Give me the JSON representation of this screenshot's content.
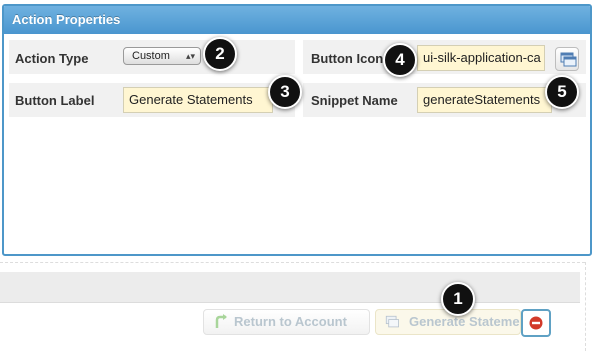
{
  "panel": {
    "title": "Action Properties"
  },
  "fields": {
    "action_type": {
      "label": "Action Type",
      "value": "Custom"
    },
    "button_icon": {
      "label": "Button Icon",
      "value": "ui-silk-application-ca"
    },
    "button_label": {
      "label": "Button Label",
      "value": "Generate Statements"
    },
    "snippet_name": {
      "label": "Snippet Name",
      "value": "generateStatements"
    }
  },
  "badges": [
    "1",
    "2",
    "3",
    "4",
    "5"
  ],
  "buttons": {
    "return_label": "Return to Account",
    "generate_label": "Generate Stateme"
  },
  "colors": {
    "panel_border": "#4d97c9",
    "header_bg": "#5aa3d8",
    "input_bg": "#fff6d2",
    "disabled_text": "#b9c6cf",
    "cancel_red": "#d23a2a"
  },
  "icons": {
    "select_arrows": "updown-arrows-icon",
    "icon_picker": "application-windows-icon",
    "return": "return-arrow-icon",
    "generate": "application-windows-icon",
    "cancel": "minus-circle-icon"
  }
}
